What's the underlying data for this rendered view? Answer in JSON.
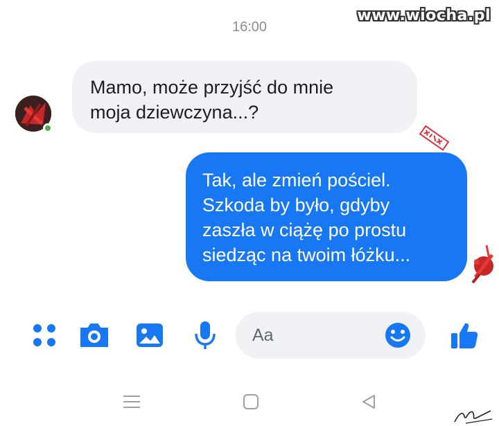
{
  "watermark": "www.wiocha.pl",
  "conversation": {
    "timestamp": "16:00",
    "incoming": {
      "lines": [
        "Mamo, może przyjść do mnie",
        "moja dziewczyna...?"
      ]
    },
    "outgoing": {
      "lines": [
        "Tak, ale zmień pościel.",
        "Szkoda by było, gdyby",
        "zaszła w ciążę po prostu",
        "siedząc na twoim łóżku..."
      ]
    }
  },
  "composer": {
    "placeholder": "Aa",
    "icons": [
      "menu-dots-icon",
      "camera-icon",
      "image-icon",
      "microphone-icon",
      "emoji-icon",
      "like-icon"
    ]
  },
  "navbar": {
    "icons": [
      "recent-apps-icon",
      "home-icon",
      "back-icon"
    ]
  },
  "colors": {
    "accent": "#1877f2",
    "incoming_bubble": "#f1f0f5",
    "online": "#4caf50"
  }
}
